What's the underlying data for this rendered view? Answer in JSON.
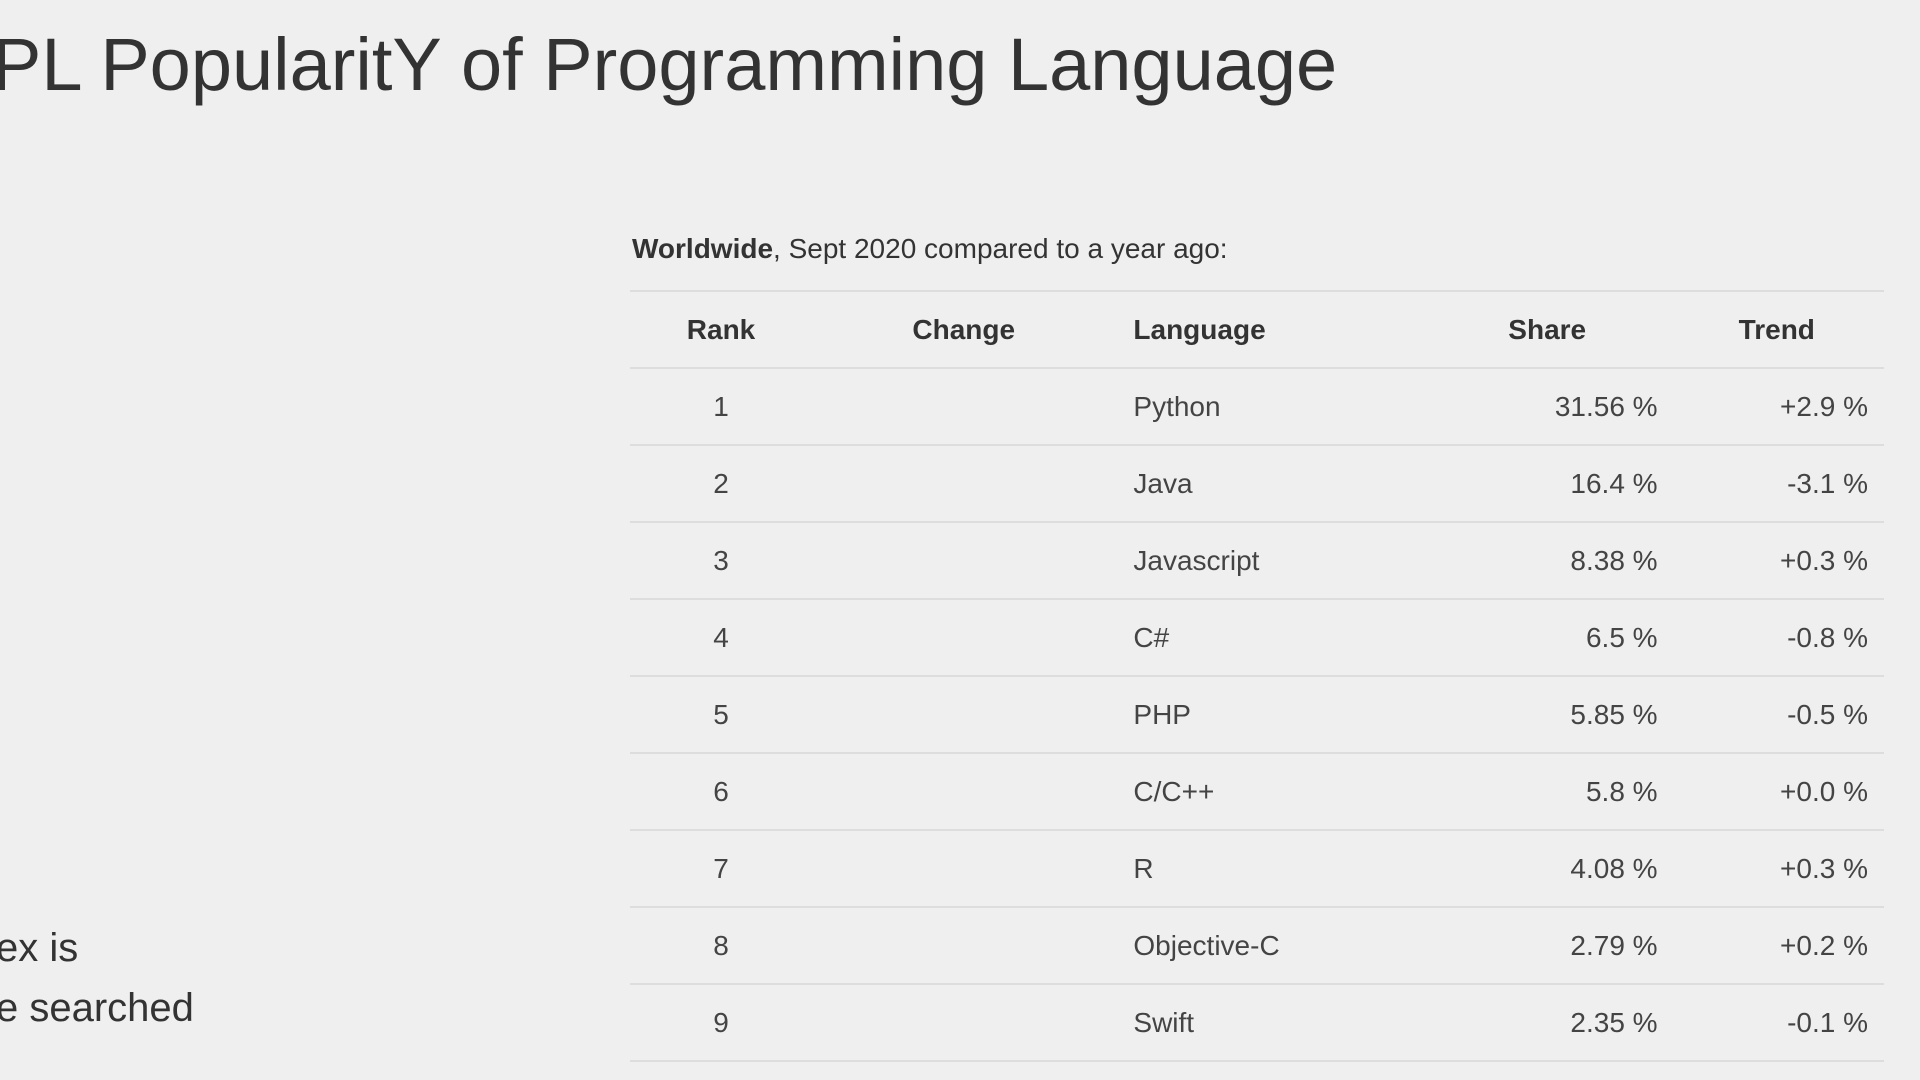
{
  "page": {
    "title": "PL PopularitY of Programming Language",
    "side_text": [
      "ex is",
      "e searched"
    ]
  },
  "table": {
    "caption_bold": "Worldwide",
    "caption_rest": ", Sept 2020 compared to a year ago:",
    "headers": {
      "rank": "Rank",
      "change": "Change",
      "language": "Language",
      "share": "Share",
      "trend": "Trend"
    },
    "rows": [
      {
        "rank": "1",
        "change": "",
        "language": "Python",
        "share": "31.56 %",
        "trend": "+2.9 %"
      },
      {
        "rank": "2",
        "change": "",
        "language": "Java",
        "share": "16.4 %",
        "trend": "-3.1 %"
      },
      {
        "rank": "3",
        "change": "",
        "language": "Javascript",
        "share": "8.38 %",
        "trend": "+0.3 %"
      },
      {
        "rank": "4",
        "change": "",
        "language": "C#",
        "share": "6.5 %",
        "trend": "-0.8 %"
      },
      {
        "rank": "5",
        "change": "",
        "language": "PHP",
        "share": "5.85 %",
        "trend": "-0.5 %"
      },
      {
        "rank": "6",
        "change": "",
        "language": "C/C++",
        "share": "5.8 %",
        "trend": "+0.0 %"
      },
      {
        "rank": "7",
        "change": "",
        "language": "R",
        "share": "4.08 %",
        "trend": "+0.3 %"
      },
      {
        "rank": "8",
        "change": "",
        "language": "Objective-C",
        "share": "2.79 %",
        "trend": "+0.2 %"
      },
      {
        "rank": "9",
        "change": "",
        "language": "Swift",
        "share": "2.35 %",
        "trend": "-0.1 %"
      }
    ]
  },
  "colors": {
    "background": "#efefef",
    "text": "#333333",
    "row_border": "#dddddd"
  }
}
